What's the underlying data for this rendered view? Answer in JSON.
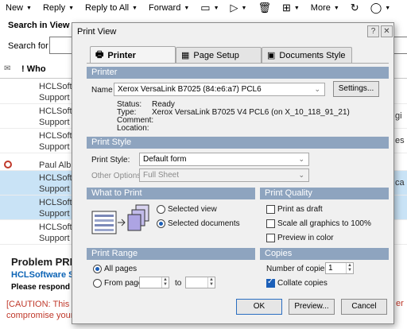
{
  "toolbar": {
    "new": "New",
    "reply": "Reply",
    "reply_all": "Reply to All",
    "forward": "Forward",
    "more": "More",
    "icons": [
      "folder-icon",
      "flag-icon",
      "trash-icon",
      "add-icon",
      "refresh-icon",
      "search-icon"
    ]
  },
  "search": {
    "title": "Search in View",
    "label": "Search for"
  },
  "list": {
    "header_who": "! Who",
    "rows": [
      {
        "line1": "HCLSoftv",
        "line2": "Support",
        "selected": false,
        "right": ""
      },
      {
        "line1": "HCLSoftv",
        "line2": "Support",
        "selected": false,
        "right": "gi"
      },
      {
        "line1": "HCLSoftv",
        "line2": "Support",
        "selected": false,
        "right": "es"
      },
      {
        "line1": "Paul Albr",
        "line2": "",
        "selected": false,
        "right": ""
      },
      {
        "line1": "HCLSoftv",
        "line2": "Support",
        "selected": true,
        "right": "ca"
      },
      {
        "line1": "HCLSoftv",
        "line2": "Support",
        "selected": true,
        "right": ""
      },
      {
        "line1": "HCLSoftv",
        "line2": "Support",
        "selected": false,
        "right": ""
      }
    ]
  },
  "preview": {
    "title": "Problem PRB",
    "link": "HCLSoftware S",
    "line": "Please respond t",
    "caution_1": "[CAUTION: This",
    "caution_2": "compromise your",
    "caution_right": "er"
  },
  "dialog": {
    "title": "Print View",
    "help_btn": "?",
    "close_btn": "✕",
    "tabs": [
      "Printer",
      "Page Setup",
      "Documents Style"
    ],
    "printer_section": {
      "header": "Printer",
      "name_label": "Name",
      "name_value": "Xerox VersaLink B7025 (84:e6:a7) PCL6",
      "settings_btn": "Settings...",
      "status_label": "Status:",
      "status_value": "Ready",
      "type_label": "Type:",
      "type_value": "Xerox VersaLink B7025 V4 PCL6 (on X_10_118_91_21)",
      "comment_label": "Comment:",
      "location_label": "Location:"
    },
    "print_style": {
      "header": "Print Style",
      "style_label": "Print Style:",
      "style_value": "Default form",
      "options_label": "Other Options:",
      "options_value": "Full Sheet"
    },
    "what_to_print": {
      "header": "What to Print",
      "opt_view": "Selected view",
      "opt_docs": "Selected documents",
      "selected": "docs"
    },
    "print_quality": {
      "header": "Print Quality",
      "draft": "Print as draft",
      "scale": "Scale all graphics to 100%",
      "preview_color": "Preview in color"
    },
    "print_range": {
      "header": "Print Range",
      "all_pages": "All pages",
      "from_page": "From page",
      "to": "to",
      "selected": "all"
    },
    "copies": {
      "header": "Copies",
      "number_label": "Number of copies",
      "number_value": "1",
      "collate": "Collate copies",
      "collate_checked": true
    },
    "buttons": {
      "ok": "OK",
      "preview": "Preview...",
      "cancel": "Cancel"
    }
  }
}
